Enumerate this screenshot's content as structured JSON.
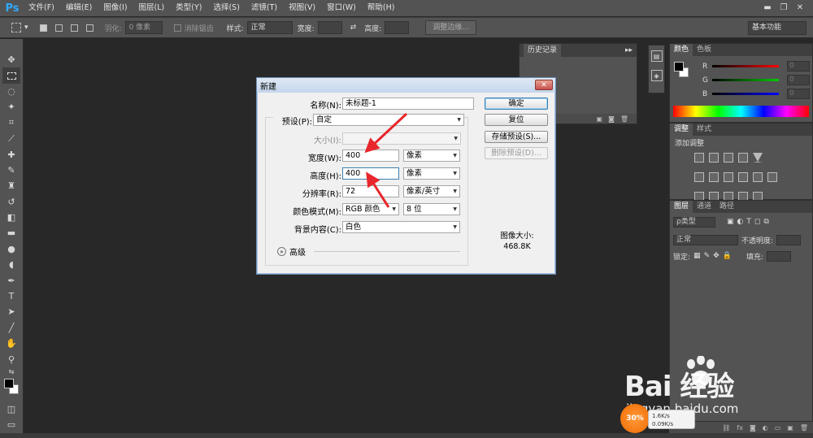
{
  "app": {
    "logo": "Ps"
  },
  "menu": [
    "文件(F)",
    "编辑(E)",
    "图像(I)",
    "图层(L)",
    "类型(Y)",
    "选择(S)",
    "滤镜(T)",
    "视图(V)",
    "窗口(W)",
    "帮助(H)"
  ],
  "window_controls": {
    "minimize": "▬",
    "restore": "❐",
    "close": "✕"
  },
  "options": {
    "feather_label": "羽化:",
    "feather_value": "0 像素",
    "antialias_label": "消除锯齿",
    "style_label": "样式:",
    "style_value": "正常",
    "width_label": "宽度:",
    "height_label": "高度:",
    "refine_edge": "调整边缘...",
    "workspace": "基本功能"
  },
  "history_panel": {
    "tab": "历史记录",
    "menu": "▸▸"
  },
  "color_panel": {
    "tabs": [
      "颜色",
      "色板"
    ],
    "channels": [
      {
        "label": "R",
        "value": "0",
        "gradient": "#ff0000"
      },
      {
        "label": "G",
        "value": "0",
        "gradient": "#00cc00"
      },
      {
        "label": "B",
        "value": "0",
        "gradient": "#0000ff"
      }
    ]
  },
  "adjustments_panel": {
    "tabs": [
      "调整",
      "样式"
    ],
    "title": "添加调整"
  },
  "layers_panel": {
    "tabs": [
      "图层",
      "通道",
      "路径"
    ],
    "kind_filter": "ρ类型",
    "blend_mode": "正常",
    "opacity_label": "不透明度:",
    "lock_label": "锁定:",
    "fill_label": "填充:"
  },
  "dialog": {
    "title": "新建",
    "close": "✕",
    "name_label": "名称(N):",
    "name_value": "未标题-1",
    "preset_label": "预设(P):",
    "preset_value": "自定",
    "size_label": "大小(I):",
    "width_label": "宽度(W):",
    "width_value": "400",
    "width_unit": "像素",
    "height_label": "高度(H):",
    "height_value": "400",
    "height_unit": "像素",
    "resolution_label": "分辨率(R):",
    "resolution_value": "72",
    "resolution_unit": "像素/英寸",
    "color_mode_label": "颜色模式(M):",
    "color_mode_value": "RGB 颜色",
    "bit_depth": "8 位",
    "background_label": "背景内容(C):",
    "background_value": "白色",
    "advanced": "高级",
    "buttons": {
      "ok": "确定",
      "reset": "复位",
      "save_preset": "存储预设(S)...",
      "delete_preset": "删除预设(D)..."
    },
    "image_size_label": "图像大小:",
    "image_size_value": "468.8K"
  },
  "watermark": {
    "brand": "Bai 经验",
    "url": "jingyan.baidu.com"
  },
  "speed_widget": {
    "percent": "30%",
    "up": "1.6K/s",
    "down": "0.09K/s"
  },
  "colors": {
    "accent_blue": "#31a8ff",
    "arrow_red": "#e8262b",
    "ui_gray": "#535353",
    "canvas_dark": "#282828"
  }
}
